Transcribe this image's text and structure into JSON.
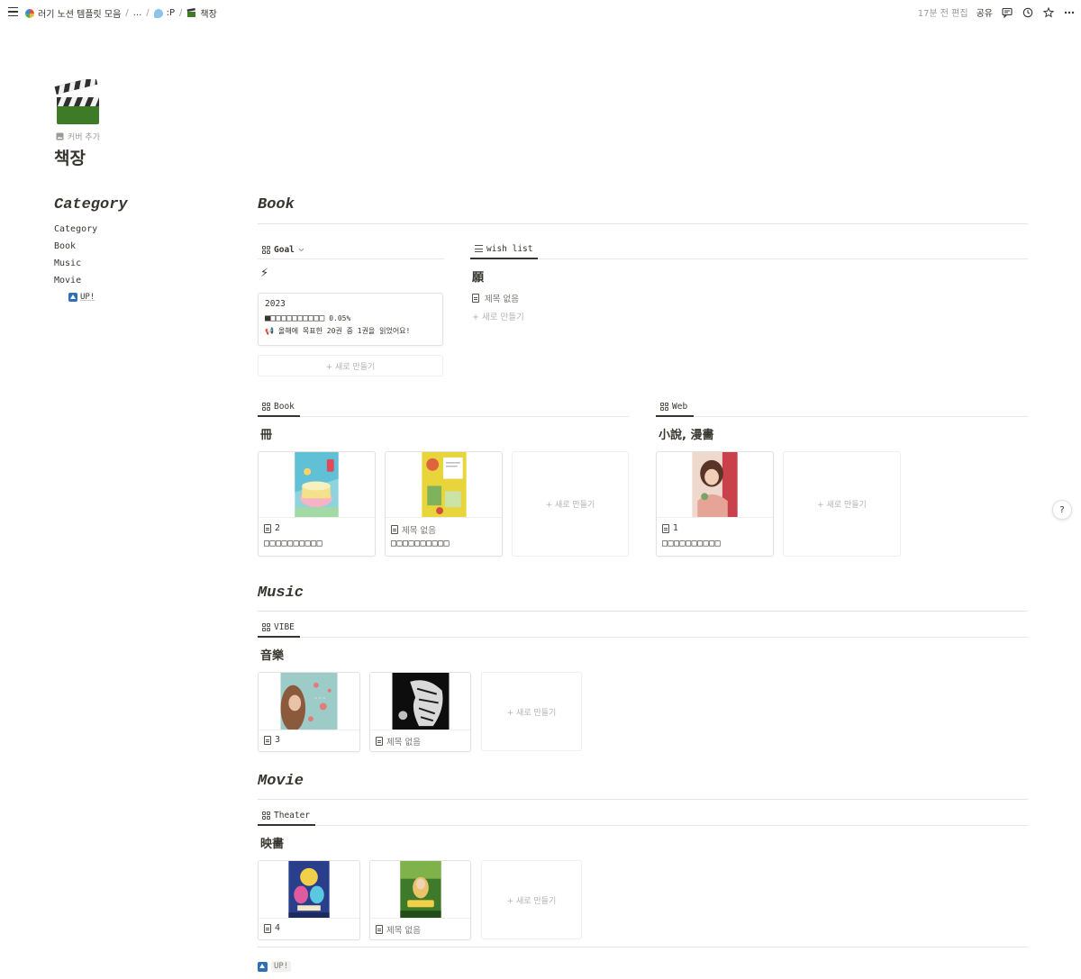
{
  "topbar": {
    "breadcrumbs": [
      "러기 노션 템플릿 모음",
      "...",
      ":P",
      "책장"
    ],
    "edited": "17분 전 편집",
    "share": "공유"
  },
  "page": {
    "add_cover": "커버 추가",
    "title": "책장"
  },
  "category": {
    "heading": "Category",
    "items": [
      "Category",
      "Book",
      "Music",
      "Movie"
    ],
    "up": "UP!"
  },
  "sections": {
    "book": "Book",
    "music": "Music",
    "movie": "Movie"
  },
  "goal": {
    "tab": "Goal",
    "emoji": "⚡",
    "year": "2023",
    "progress_boxes": "■□□□□□□□□□□",
    "percent": "0.05%",
    "message": "올해에 목표한 20권 중 1권을 읽었어요!",
    "progress_fraction": 0.05,
    "new": "+ 새로 만들기"
  },
  "wishlist": {
    "tab": "wish list",
    "title": "願",
    "item": "제목 없음",
    "new": "+ 새로 만들기"
  },
  "book_db": {
    "tab": "Book",
    "title": "冊",
    "cards": [
      {
        "name": "2",
        "boxes": "□□□□□□□□□□"
      },
      {
        "name": "제목 없음",
        "boxes": "□□□□□□□□□□"
      }
    ],
    "new": "+ 새로 만들기"
  },
  "web_db": {
    "tab": "Web",
    "title": "小說, 漫畵",
    "cards": [
      {
        "name": "1",
        "boxes": "□□□□□□□□□□"
      }
    ],
    "new": "+ 새로 만들기"
  },
  "music_db": {
    "tab": "VIBE",
    "title": "音樂",
    "cards": [
      {
        "name": "3"
      },
      {
        "name": "제목 없음"
      }
    ],
    "new": "+ 새로 만들기"
  },
  "movie_db": {
    "tab": "Theater",
    "title": "映畵",
    "cards": [
      {
        "name": "4"
      },
      {
        "name": "제목 없음"
      }
    ],
    "new": "+ 새로 만들기"
  },
  "help": "?",
  "bottom_up": "UP!",
  "colors": {
    "text": "#37352f",
    "muted": "#9b9a97",
    "up_icon": "#2e6fb5",
    "divider": "#e4e3e0"
  }
}
